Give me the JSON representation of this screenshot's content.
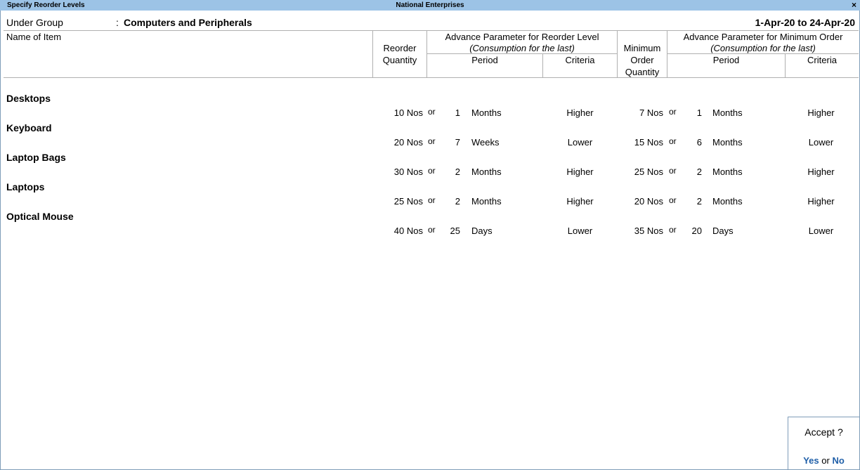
{
  "titlebar": {
    "left": "Specify Reorder Levels",
    "center": "National Enterprises",
    "close": "×"
  },
  "group": {
    "label": "Under Group",
    "sep": ":",
    "value": "Computers and Peripherals",
    "period": "1-Apr-20 to 24-Apr-20"
  },
  "headers": {
    "name_of_item": "Name of Item",
    "reorder_l1": "Reorder",
    "reorder_l2": "Quantity",
    "adv_reorder_l1": "Advance Parameter for Reorder Level",
    "adv_reorder_l2": "(Consumption for the last)",
    "period": "Period",
    "criteria": "Criteria",
    "min_l1": "Minimum",
    "min_l2": "Order",
    "min_l3": "Quantity",
    "adv_min_l1": "Advance Parameter for Minimum Order",
    "adv_min_l2": "(Consumption for the last)",
    "period2": "Period",
    "criteria2": "Criteria"
  },
  "items": [
    {
      "name": "Desktops",
      "reorder": "10 Nos",
      "or1": "or",
      "p1n": "1",
      "p1u": "Months",
      "c1": "Higher",
      "min": "7 Nos",
      "or2": "or",
      "p2n": "1",
      "p2u": "Months",
      "c2": "Higher"
    },
    {
      "name": "Keyboard",
      "reorder": "20 Nos",
      "or1": "or",
      "p1n": "7",
      "p1u": "Weeks",
      "c1": "Lower",
      "min": "15 Nos",
      "or2": "or",
      "p2n": "6",
      "p2u": "Months",
      "c2": "Lower"
    },
    {
      "name": "Laptop Bags",
      "reorder": "30 Nos",
      "or1": "or",
      "p1n": "2",
      "p1u": "Months",
      "c1": "Higher",
      "min": "25 Nos",
      "or2": "or",
      "p2n": "2",
      "p2u": "Months",
      "c2": "Higher"
    },
    {
      "name": "Laptops",
      "reorder": "25 Nos",
      "or1": "or",
      "p1n": "2",
      "p1u": "Months",
      "c1": "Higher",
      "min": "20 Nos",
      "or2": "or",
      "p2n": "2",
      "p2u": "Months",
      "c2": "Higher"
    },
    {
      "name": "Optical Mouse",
      "reorder": "40 Nos",
      "or1": "or",
      "p1n": "25",
      "p1u": "Days",
      "c1": "Lower",
      "min": "35 Nos",
      "or2": "or",
      "p2n": "20",
      "p2u": "Days",
      "c2": "Lower"
    }
  ],
  "accept": {
    "question": "Accept ?",
    "yes": "Yes",
    "or": "or",
    "no": "No"
  }
}
